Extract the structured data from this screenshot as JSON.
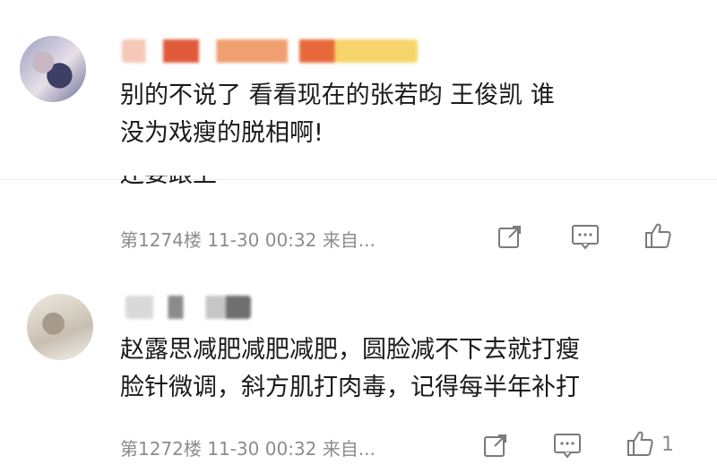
{
  "comments": [
    {
      "text": "别的不说了 看看现在的张若昀 王俊凯 谁\n没为戏瘦的脱相啊!",
      "overlap_text": "还要跟上",
      "floor": "第1274楼",
      "time": "11-30 00:32",
      "source": "来自...",
      "likes": ""
    },
    {
      "text": "赵露思减肥减肥减肥，圆脸减不下去就打瘦\n脸针微调，斜方肌打肉毒，记得每半年补打",
      "floor": "第1272楼",
      "time": "11-30 00:32",
      "source": "来自...",
      "likes": "1"
    }
  ],
  "icons": [
    "share-icon",
    "comment-icon",
    "thumbs-up-icon"
  ],
  "colors": {
    "text": "#1a1a1a",
    "meta": "#8c8c8c",
    "icon": "#7a7a7a"
  }
}
